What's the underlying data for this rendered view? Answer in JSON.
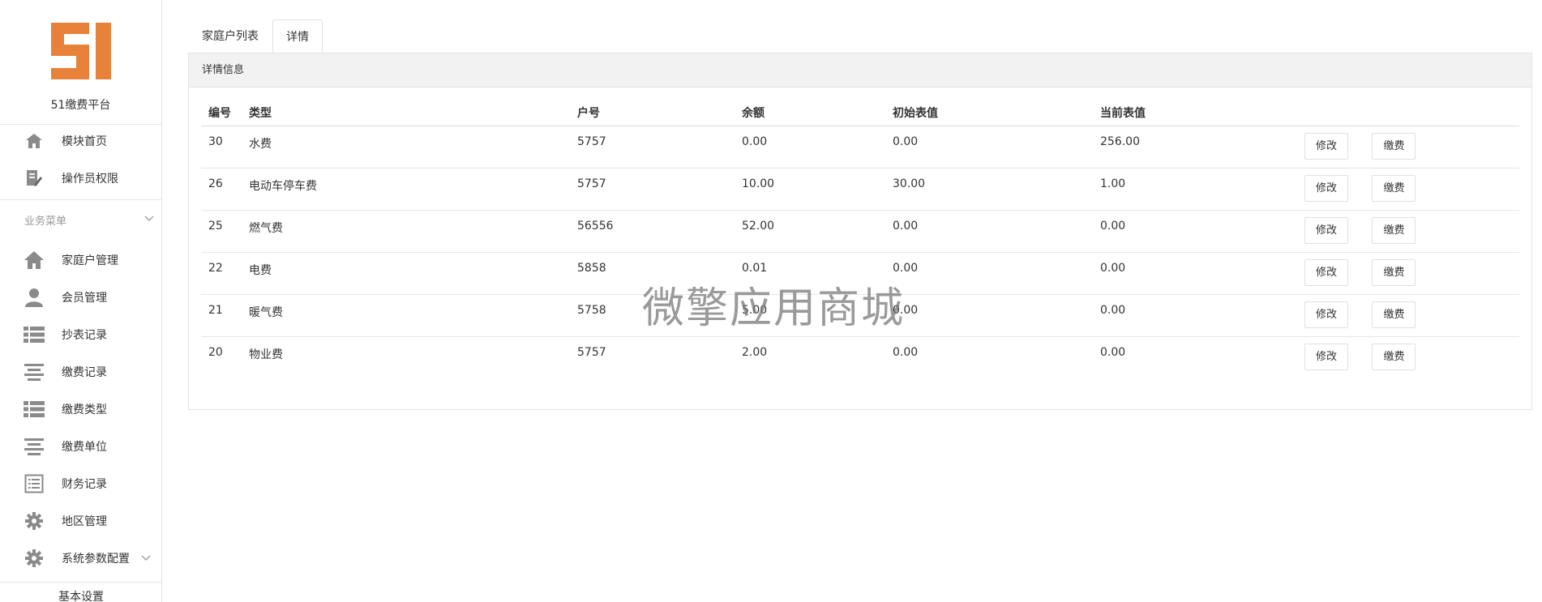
{
  "brand": {
    "logo_text": "51",
    "platform_name": "51缴费平台",
    "logo_color": "#e8823a"
  },
  "sidebar": {
    "top_items": [
      {
        "label": "模块首页",
        "icon": "home-icon"
      },
      {
        "label": "操作员权限",
        "icon": "edit-document-icon"
      }
    ],
    "section_title": "业务菜单",
    "items": [
      {
        "label": "家庭户管理",
        "icon": "house-icon"
      },
      {
        "label": "会员管理",
        "icon": "user-icon"
      },
      {
        "label": "抄表记录",
        "icon": "list-icon"
      },
      {
        "label": "缴费记录",
        "icon": "align-icon"
      },
      {
        "label": "缴费类型",
        "icon": "list-icon"
      },
      {
        "label": "缴费单位",
        "icon": "align-icon"
      },
      {
        "label": "财务记录",
        "icon": "ledger-icon"
      },
      {
        "label": "地区管理",
        "icon": "gear-icon"
      },
      {
        "label": "系统参数配置",
        "icon": "gear-icon"
      }
    ],
    "sub_item": "基本设置"
  },
  "tabs": [
    {
      "label": "家庭户列表",
      "active": false
    },
    {
      "label": "详情",
      "active": true
    }
  ],
  "panel": {
    "title": "详情信息"
  },
  "table": {
    "headers": [
      "编号",
      "类型",
      "户号",
      "余额",
      "初始表值",
      "当前表值",
      ""
    ],
    "rows": [
      {
        "id": "30",
        "type": "水费",
        "account": "5757",
        "balance": "0.00",
        "initial": "0.00",
        "current": "256.00"
      },
      {
        "id": "26",
        "type": "电动车停车费",
        "account": "5757",
        "balance": "10.00",
        "initial": "30.00",
        "current": "1.00"
      },
      {
        "id": "25",
        "type": "燃气费",
        "account": "56556",
        "balance": "52.00",
        "initial": "0.00",
        "current": "0.00"
      },
      {
        "id": "22",
        "type": "电费",
        "account": "5858",
        "balance": "0.01",
        "initial": "0.00",
        "current": "0.00"
      },
      {
        "id": "21",
        "type": "暖气费",
        "account": "5758",
        "balance": "5.00",
        "initial": "0.00",
        "current": "0.00"
      },
      {
        "id": "20",
        "type": "物业费",
        "account": "5757",
        "balance": "2.00",
        "initial": "0.00",
        "current": "0.00"
      }
    ],
    "edit_label": "修改",
    "pay_label": "缴费"
  },
  "watermark": "微擎应用商城"
}
